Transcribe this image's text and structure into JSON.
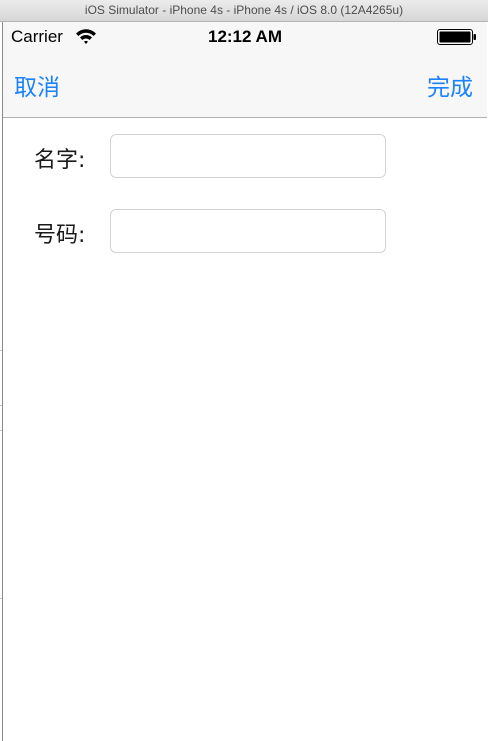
{
  "window": {
    "title": "iOS Simulator - iPhone 4s - iPhone 4s / iOS 8.0 (12A4265u)"
  },
  "status_bar": {
    "carrier": "Carrier",
    "time": "12:12 AM",
    "wifi_icon": "wifi-icon",
    "battery_icon": "battery-full-icon"
  },
  "nav_bar": {
    "left_button": "取消",
    "right_button": "完成"
  },
  "form": {
    "name_label": "名字:",
    "name_value": "",
    "phone_label": "号码:",
    "phone_value": ""
  },
  "colors": {
    "tint": "#1a82fb",
    "bar_background": "#f7f7f7",
    "field_border": "#d2d2d2"
  }
}
